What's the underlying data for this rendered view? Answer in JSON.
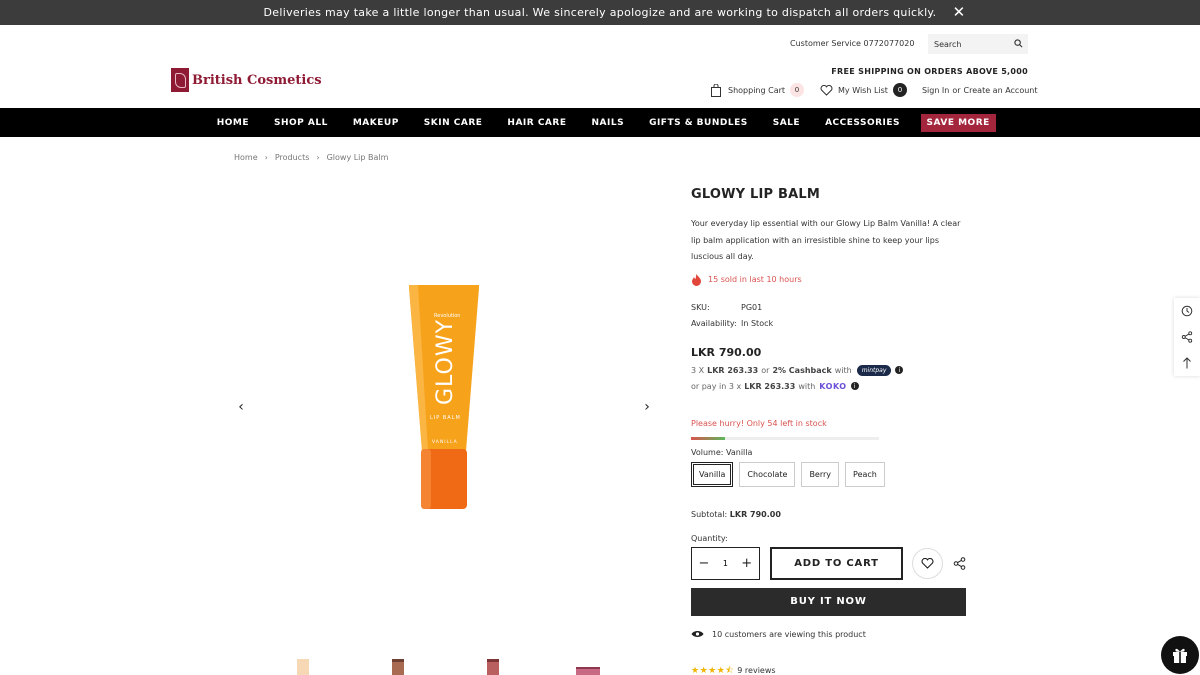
{
  "announcement": {
    "text": "Deliveries may take a little longer than usual. We sincerely apologize and are working to dispatch all orders quickly.",
    "close_icon": "close-icon"
  },
  "header": {
    "customer_service": "Customer Service 0772077020",
    "search_placeholder": "Search",
    "logo_text": "British Cosmetics",
    "free_shipping": "FREE SHIPPING ON ORDERS ABOVE 5,000",
    "cart_label": "Shopping Cart",
    "cart_count": "0",
    "wishlist_label": "My Wish List",
    "wishlist_count": "0",
    "sign_in": "Sign In",
    "or": "or",
    "create_account": "Create an Account"
  },
  "nav": {
    "items": [
      "HOME",
      "SHOP ALL",
      "MAKEUP",
      "SKIN CARE",
      "HAIR CARE",
      "NAILS",
      "GIFTS & BUNDLES",
      "SALE",
      "ACCESSORIES"
    ],
    "highlight": "SAVE MORE"
  },
  "breadcrumb": [
    "Home",
    "Products",
    "Glowy Lip Balm"
  ],
  "product": {
    "image_brand": "GLOWY",
    "image_subtitle": "LIP BALM",
    "image_variant": "VANILLA",
    "title": "GLOWY LIP BALM",
    "description": "Your everyday lip essential with our Glowy Lip Balm Vanilla! A clear lip balm application with an irresistible shine to keep your lips luscious all day.",
    "sold_text": "15 sold in last 10 hours",
    "sku_label": "SKU:",
    "sku": "PG01",
    "availability_label": "Availability:",
    "availability": "In Stock",
    "price": "LKR 790.00",
    "installment": {
      "prefix": "3 X",
      "amount": "LKR 263.33",
      "or": "or",
      "cashback": "2% Cashback",
      "with": "with",
      "provider": "mintpay"
    },
    "koko": {
      "prefix": "or pay in 3 x",
      "amount": "LKR 263.33",
      "with": "with",
      "provider": "KOKO"
    },
    "hurry": "Please hurry! Only 54 left in stock",
    "stock_fraction": 0.18,
    "volume_label": "Volume:",
    "volume_selected": "Vanilla",
    "options": [
      "Vanilla",
      "Chocolate",
      "Berry",
      "Peach"
    ],
    "subtotal_label": "Subtotal:",
    "subtotal": "LKR 790.00",
    "quantity_label": "Quantity:",
    "quantity": "1",
    "add_to_cart": "ADD TO CART",
    "buy_now": "BUY IT NOW",
    "viewing": "10 customers are viewing this product",
    "rating_stars": 4.5,
    "reviews": "9 reviews"
  },
  "colors": {
    "accent": "#a3263c",
    "brand": "#8e1a34",
    "tube": "#f7a21b",
    "cap": "#f06a16"
  }
}
